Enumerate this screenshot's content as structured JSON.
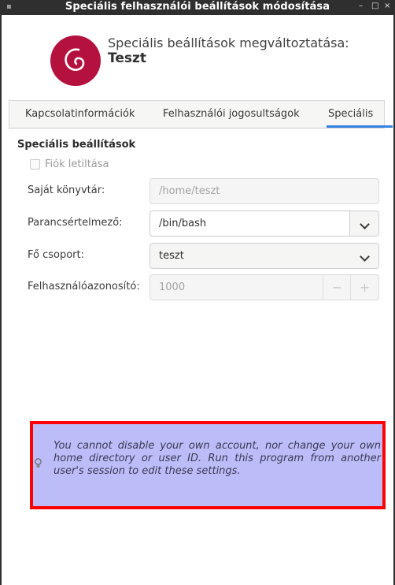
{
  "window": {
    "title": "Speciális felhasználói beállítások módosítása",
    "minimize_glyph": "–",
    "maximize_glyph": "□",
    "close_glyph": "×"
  },
  "header": {
    "label": "Speciális beállítások megváltoztatása:",
    "username": "Teszt",
    "logo_icon": "debian-swirl-icon",
    "logo_color": "#b5113f"
  },
  "tabs": [
    {
      "label": "Kapcsolatinformációk",
      "active": false
    },
    {
      "label": "Felhasználói jogosultságok",
      "active": false
    },
    {
      "label": "Speciális",
      "active": true
    }
  ],
  "accent_color": "#3584e4",
  "section": {
    "title": "Speciális beállítások",
    "disable_account_label": "Fiók letiltása",
    "disable_account_checked": false
  },
  "fields": {
    "home_dir": {
      "label": "Saját könyvtár:",
      "value": "/home/teszt",
      "disabled": true
    },
    "shell": {
      "label": "Parancsértelmező:",
      "value": "/bin/bash"
    },
    "group": {
      "label": "Fő csoport:",
      "value": "teszt"
    },
    "uid": {
      "label": "Felhasználóazonosító:",
      "value": "1000",
      "disabled": true,
      "minus": "−",
      "plus": "+"
    }
  },
  "warning": {
    "text": "You cannot disable your own account, nor change your own home directory or user ID. Run this program from another user's session to edit these settings.",
    "background": "#bcbcf8",
    "outline": "#ff0000"
  }
}
